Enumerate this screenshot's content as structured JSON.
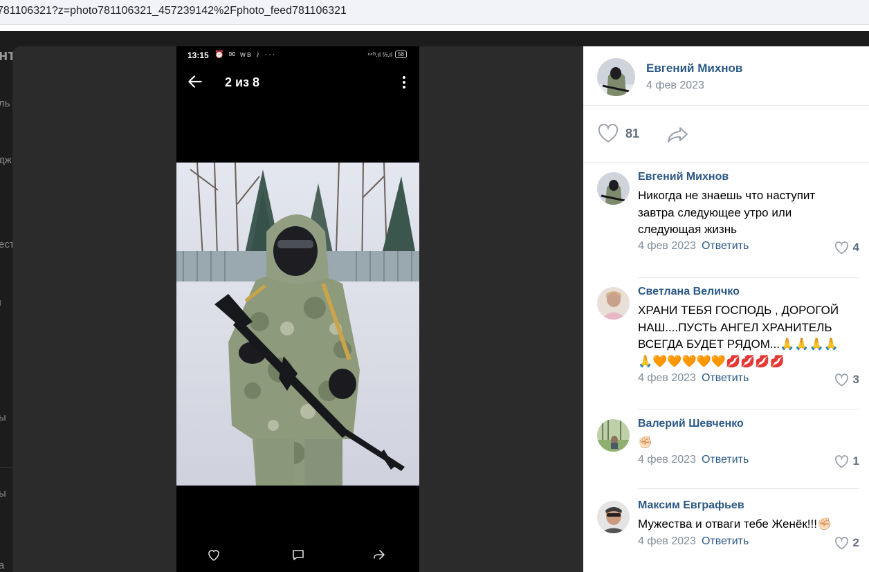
{
  "browser": {
    "url": "781106321?z=photo781106321_457239142%2Fphoto_feed781106321"
  },
  "background_page": {
    "fragments": [
      "нт",
      "ль",
      "дж",
      "ест",
      "ı",
      "ы",
      "ы",
      "а"
    ]
  },
  "phone": {
    "status_time": "13:15",
    "status_icons": "⏰ ✉ ᴡʙ ♪ ···",
    "status_right": "ⁿ⁴ᴳ.ıl ⅔.ıl",
    "battery": "58",
    "counter": "2 из 8",
    "icons": [
      "back-arrow-icon",
      "more-vertical-icon",
      "heart-icon",
      "comment-icon",
      "share-icon"
    ]
  },
  "post": {
    "author_name": "Евгений Михнов",
    "date": "4 фев 2023",
    "likes": "81"
  },
  "comments": [
    {
      "author": "Евгений Михнов",
      "text": "Никогда не знаешь что наступит завтра следующее утро или следующая жизнь",
      "date": "4 фев 2023",
      "reply": "Ответить",
      "likes": "4"
    },
    {
      "author": "Светлана Величко",
      "text": "ХРАНИ ТЕБЯ ГОСПОДЬ , ДОРОГОЙ НАШ....ПУСТЬ АНГЕЛ ХРАНИТЕЛЬ ВСЕГДА БУДЕТ РЯДОМ...🙏🙏🙏🙏🙏🧡🧡🧡🧡🧡💋💋💋💋",
      "date": "4 фев 2023",
      "reply": "Ответить",
      "likes": "3"
    },
    {
      "author": "Валерий Шевченко",
      "text": "✊🏻",
      "date": "4 фев 2023",
      "reply": "Ответить",
      "likes": "1"
    },
    {
      "author": "Максим Евграфьев",
      "text": "Мужества и отваги тебе Женёк!!!✊🏻",
      "date": "4 фев 2023",
      "reply": "Ответить",
      "likes": "2"
    }
  ],
  "colors": {
    "link": "#2a5885",
    "muted": "#818c99",
    "viewer_bg": "#2b2b2b"
  }
}
